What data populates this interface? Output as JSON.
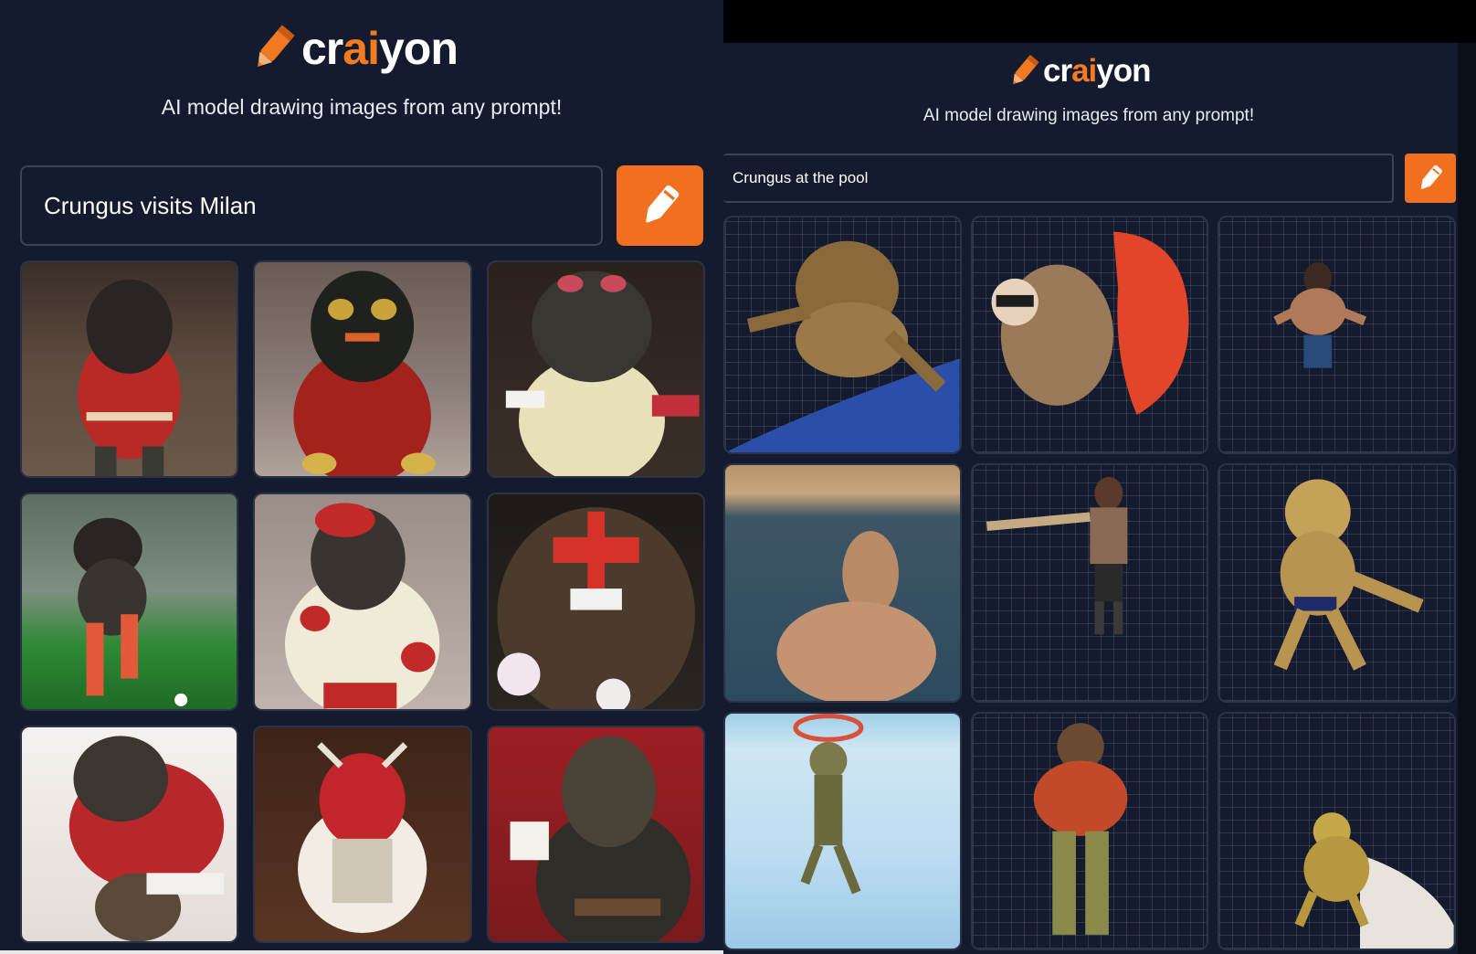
{
  "left": {
    "brand": {
      "prefix": "cr",
      "ai": "ai",
      "suffix": "yon"
    },
    "tagline": "AI model drawing images from any prompt!",
    "prompt": {
      "value": "Crungus visits Milan"
    },
    "draw_button_icon": "pencil-icon",
    "images": [
      {
        "alt": "crungus-in-red-kit-stadium"
      },
      {
        "alt": "crungus-red-velvet-masked"
      },
      {
        "alt": "crungus-cream-jersey-dark-bg"
      },
      {
        "alt": "crungus-running-on-pitch"
      },
      {
        "alt": "crungus-white-red-costume"
      },
      {
        "alt": "crungus-red-face-paint-closeup"
      },
      {
        "alt": "crungus-red-shirt-white-bg"
      },
      {
        "alt": "crungus-red-beard-theatre"
      },
      {
        "alt": "crungus-holding-card-red-wall"
      }
    ]
  },
  "right": {
    "brand": {
      "prefix": "cr",
      "ai": "ai",
      "suffix": "yon"
    },
    "tagline": "AI model drawing images from any prompt!",
    "prompt": {
      "value": "Crungus at the pool"
    },
    "draw_button_icon": "pencil-icon",
    "images": [
      {
        "alt": "crungus-swimming-pool-edge"
      },
      {
        "alt": "crungus-with-inflatable"
      },
      {
        "alt": "crungus-crouching-in-pool"
      },
      {
        "alt": "crungus-floating-dark-pool"
      },
      {
        "alt": "crungus-standing-pool-side"
      },
      {
        "alt": "crungus-wading-blue-pool"
      },
      {
        "alt": "crungus-leaping-into-pool"
      },
      {
        "alt": "crungus-standing-in-tiled-pool"
      },
      {
        "alt": "crungus-golden-in-pool"
      }
    ]
  },
  "colors": {
    "accent": "#f0701f",
    "background": "#141b2e",
    "border": "#3a4358"
  }
}
